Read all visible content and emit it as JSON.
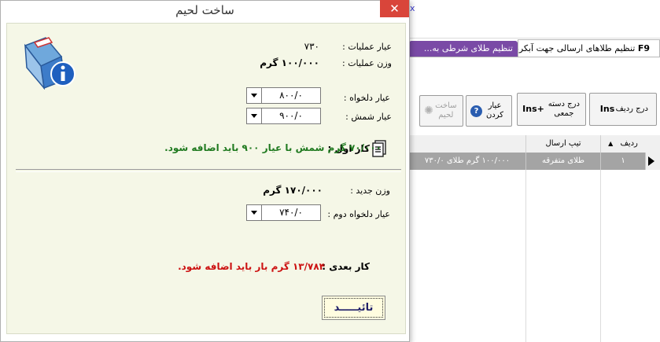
{
  "background": {
    "top_link": "x",
    "tab_active": {
      "key": "F9",
      "label": "تنظیم طلاهای ارسالی جهت آبکردن"
    },
    "tab_other": {
      "label": "تنظیم طلای شرطی به..."
    },
    "toolbar": {
      "insert_row": {
        "label": "درج ردیف",
        "key": "Ins"
      },
      "insert_batch": {
        "label": "درج دسته جمعی",
        "key": "+Ins"
      },
      "assay": {
        "label": "عیار کردن"
      },
      "make_solder": {
        "label": "ساخت لحیم"
      }
    },
    "grid": {
      "columns": [
        "ردیف",
        "تیپ ارسال",
        ""
      ],
      "rows": [
        {
          "row_no": "۱",
          "type": "طلای متفرقه",
          "desc": "۱۰۰/۰۰۰ گرم طلای ۷۳۰/۰"
        }
      ]
    }
  },
  "dialog": {
    "title": "ساخت لحیم",
    "close": "✕",
    "op_assay_label": "عیار عملیات :",
    "op_assay_value": "۷۳۰",
    "op_weight_label": "وزن عملیات :",
    "op_weight_value": "۱۰۰/۰۰۰ گرم",
    "desired_assay_label": "عیار دلخواه :",
    "desired_assay_value": "۸۰۰/۰",
    "ingot_assay_label": "عیار شمش :",
    "ingot_assay_value": "۹۰۰/۰",
    "first_work_label": "کار اول :",
    "first_work_msg": "۷۰/۰۰۰ گرم شمش با عیار ۹۰۰ باید اضافه شود.",
    "new_weight_label": "وزن جدید :",
    "new_weight_value": "۱۷۰/۰۰۰ گرم",
    "second_assay_label": "عیار دلخواه دوم :",
    "second_assay_value": "۷۴۰/۰",
    "next_work_label": "کار بعدی :",
    "next_work_msg": "۱۳/۷۸۴ گرم بار باید اضافه شود.",
    "ok_label": "تائیـــــد"
  }
}
